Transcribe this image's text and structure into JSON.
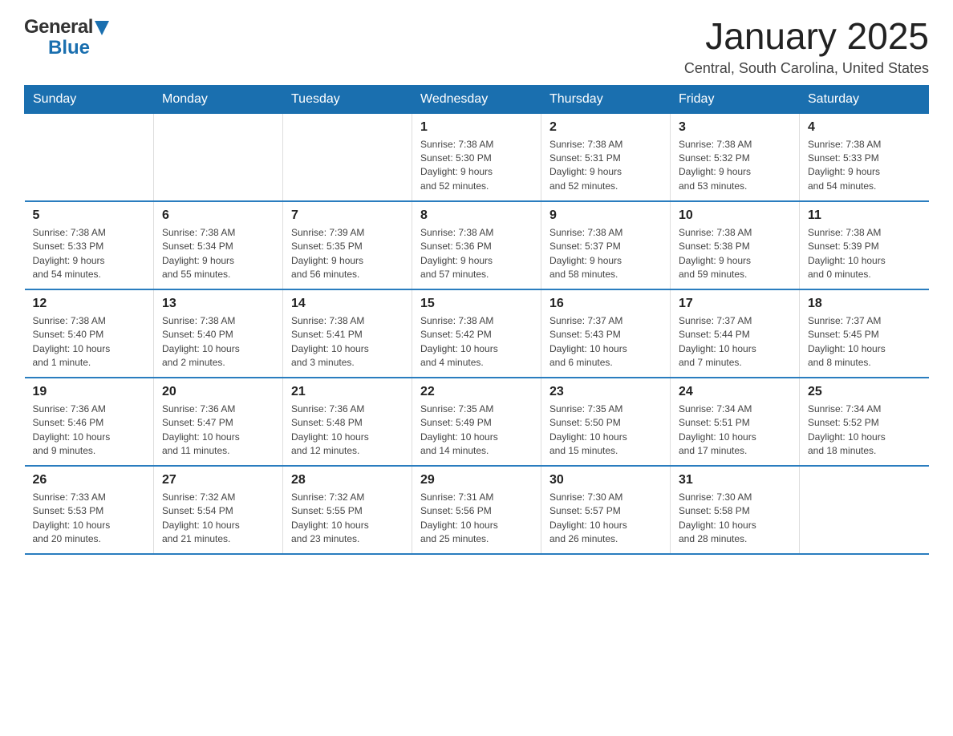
{
  "header": {
    "logo": {
      "text_general": "General",
      "text_blue": "Blue",
      "triangle_color": "#1a6faf"
    },
    "title": "January 2025",
    "location": "Central, South Carolina, United States"
  },
  "calendar": {
    "days_of_week": [
      "Sunday",
      "Monday",
      "Tuesday",
      "Wednesday",
      "Thursday",
      "Friday",
      "Saturday"
    ],
    "weeks": [
      [
        {
          "day": "",
          "info": ""
        },
        {
          "day": "",
          "info": ""
        },
        {
          "day": "",
          "info": ""
        },
        {
          "day": "1",
          "info": "Sunrise: 7:38 AM\nSunset: 5:30 PM\nDaylight: 9 hours\nand 52 minutes."
        },
        {
          "day": "2",
          "info": "Sunrise: 7:38 AM\nSunset: 5:31 PM\nDaylight: 9 hours\nand 52 minutes."
        },
        {
          "day": "3",
          "info": "Sunrise: 7:38 AM\nSunset: 5:32 PM\nDaylight: 9 hours\nand 53 minutes."
        },
        {
          "day": "4",
          "info": "Sunrise: 7:38 AM\nSunset: 5:33 PM\nDaylight: 9 hours\nand 54 minutes."
        }
      ],
      [
        {
          "day": "5",
          "info": "Sunrise: 7:38 AM\nSunset: 5:33 PM\nDaylight: 9 hours\nand 54 minutes."
        },
        {
          "day": "6",
          "info": "Sunrise: 7:38 AM\nSunset: 5:34 PM\nDaylight: 9 hours\nand 55 minutes."
        },
        {
          "day": "7",
          "info": "Sunrise: 7:39 AM\nSunset: 5:35 PM\nDaylight: 9 hours\nand 56 minutes."
        },
        {
          "day": "8",
          "info": "Sunrise: 7:38 AM\nSunset: 5:36 PM\nDaylight: 9 hours\nand 57 minutes."
        },
        {
          "day": "9",
          "info": "Sunrise: 7:38 AM\nSunset: 5:37 PM\nDaylight: 9 hours\nand 58 minutes."
        },
        {
          "day": "10",
          "info": "Sunrise: 7:38 AM\nSunset: 5:38 PM\nDaylight: 9 hours\nand 59 minutes."
        },
        {
          "day": "11",
          "info": "Sunrise: 7:38 AM\nSunset: 5:39 PM\nDaylight: 10 hours\nand 0 minutes."
        }
      ],
      [
        {
          "day": "12",
          "info": "Sunrise: 7:38 AM\nSunset: 5:40 PM\nDaylight: 10 hours\nand 1 minute."
        },
        {
          "day": "13",
          "info": "Sunrise: 7:38 AM\nSunset: 5:40 PM\nDaylight: 10 hours\nand 2 minutes."
        },
        {
          "day": "14",
          "info": "Sunrise: 7:38 AM\nSunset: 5:41 PM\nDaylight: 10 hours\nand 3 minutes."
        },
        {
          "day": "15",
          "info": "Sunrise: 7:38 AM\nSunset: 5:42 PM\nDaylight: 10 hours\nand 4 minutes."
        },
        {
          "day": "16",
          "info": "Sunrise: 7:37 AM\nSunset: 5:43 PM\nDaylight: 10 hours\nand 6 minutes."
        },
        {
          "day": "17",
          "info": "Sunrise: 7:37 AM\nSunset: 5:44 PM\nDaylight: 10 hours\nand 7 minutes."
        },
        {
          "day": "18",
          "info": "Sunrise: 7:37 AM\nSunset: 5:45 PM\nDaylight: 10 hours\nand 8 minutes."
        }
      ],
      [
        {
          "day": "19",
          "info": "Sunrise: 7:36 AM\nSunset: 5:46 PM\nDaylight: 10 hours\nand 9 minutes."
        },
        {
          "day": "20",
          "info": "Sunrise: 7:36 AM\nSunset: 5:47 PM\nDaylight: 10 hours\nand 11 minutes."
        },
        {
          "day": "21",
          "info": "Sunrise: 7:36 AM\nSunset: 5:48 PM\nDaylight: 10 hours\nand 12 minutes."
        },
        {
          "day": "22",
          "info": "Sunrise: 7:35 AM\nSunset: 5:49 PM\nDaylight: 10 hours\nand 14 minutes."
        },
        {
          "day": "23",
          "info": "Sunrise: 7:35 AM\nSunset: 5:50 PM\nDaylight: 10 hours\nand 15 minutes."
        },
        {
          "day": "24",
          "info": "Sunrise: 7:34 AM\nSunset: 5:51 PM\nDaylight: 10 hours\nand 17 minutes."
        },
        {
          "day": "25",
          "info": "Sunrise: 7:34 AM\nSunset: 5:52 PM\nDaylight: 10 hours\nand 18 minutes."
        }
      ],
      [
        {
          "day": "26",
          "info": "Sunrise: 7:33 AM\nSunset: 5:53 PM\nDaylight: 10 hours\nand 20 minutes."
        },
        {
          "day": "27",
          "info": "Sunrise: 7:32 AM\nSunset: 5:54 PM\nDaylight: 10 hours\nand 21 minutes."
        },
        {
          "day": "28",
          "info": "Sunrise: 7:32 AM\nSunset: 5:55 PM\nDaylight: 10 hours\nand 23 minutes."
        },
        {
          "day": "29",
          "info": "Sunrise: 7:31 AM\nSunset: 5:56 PM\nDaylight: 10 hours\nand 25 minutes."
        },
        {
          "day": "30",
          "info": "Sunrise: 7:30 AM\nSunset: 5:57 PM\nDaylight: 10 hours\nand 26 minutes."
        },
        {
          "day": "31",
          "info": "Sunrise: 7:30 AM\nSunset: 5:58 PM\nDaylight: 10 hours\nand 28 minutes."
        },
        {
          "day": "",
          "info": ""
        }
      ]
    ]
  }
}
